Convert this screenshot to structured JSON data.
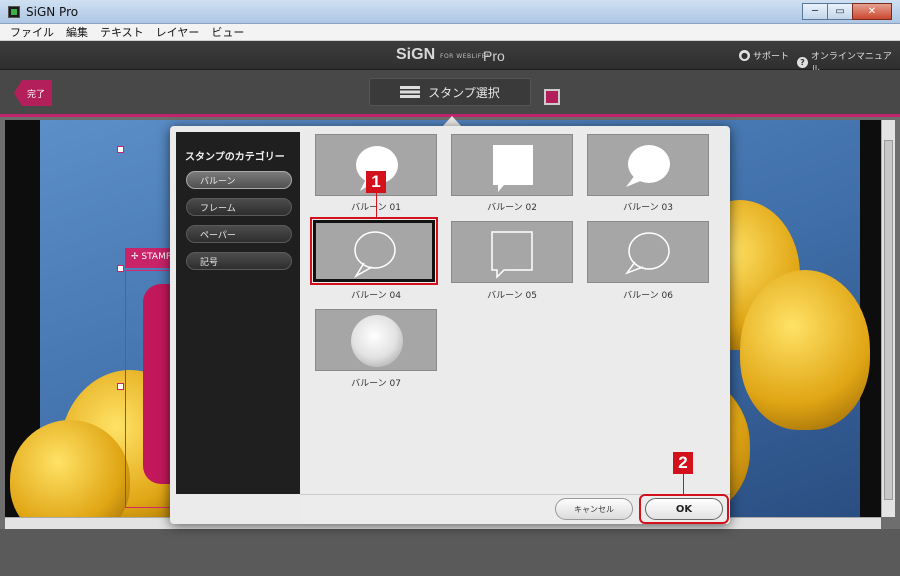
{
  "window": {
    "title": "SiGN Pro",
    "minimize": "─",
    "restore": "▭",
    "close": "✕"
  },
  "menu": [
    "ファイル",
    "編集",
    "テキスト",
    "レイヤー",
    "ビュー"
  ],
  "header": {
    "brand": "SiGN",
    "brand_sub": "FOR WEBLIFE*",
    "brand_pro": "Pro",
    "support": "サポート",
    "manual": "オンラインマニュアル"
  },
  "toolbar": {
    "done": "完了",
    "stamp_select": "スタンプ選択",
    "stamp_color": "#b21f5a"
  },
  "canvas": {
    "stamp_tag": "✢ STAMP"
  },
  "dialog": {
    "category_title": "スタンプのカテゴリー",
    "categories": [
      "バルーン",
      "フレーム",
      "ペーパー",
      "記号"
    ],
    "active_category": "バルーン",
    "stamps": [
      "バルーン 01",
      "バルーン 02",
      "バルーン 03",
      "バルーン 04",
      "バルーン 05",
      "バルーン 06",
      "バルーン 07"
    ],
    "selected_stamp": "バルーン 04",
    "cancel": "キャンセル",
    "ok": "OK"
  },
  "callouts": [
    "1",
    "2"
  ],
  "colors": {
    "accent": "#c0246d",
    "callout": "#d3111c"
  }
}
